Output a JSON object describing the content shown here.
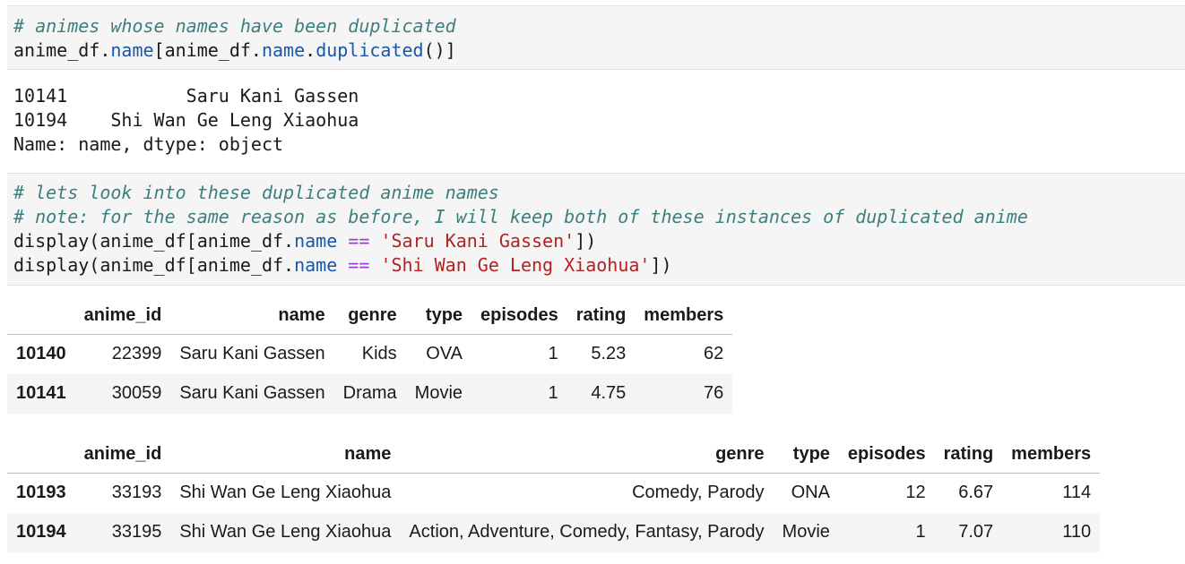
{
  "cell1": {
    "comment": "# animes whose names have been duplicated",
    "code": {
      "obj1": "anime_df.",
      "attr1": "name",
      "bracket1": "[anime_df.",
      "attr2": "name",
      "dot": ".",
      "fn": "duplicated",
      "tail": "()]"
    }
  },
  "output1": {
    "lines": [
      "10141           Saru Kani Gassen",
      "10194    Shi Wan Ge Leng Xiaohua",
      "Name: name, dtype: object"
    ]
  },
  "cell2": {
    "comment1": "# lets look into these duplicated anime names",
    "comment2": "# note: for the same reason as before, I will keep both of these instances of duplicated anime",
    "line3": {
      "pre": "display(anime_df[anime_df.",
      "attr": "name",
      "op": "==",
      "str": "'Saru Kani Gassen'",
      "post": "])"
    },
    "line4": {
      "pre": "display(anime_df[anime_df.",
      "attr": "name",
      "op": "==",
      "str": "'Shi Wan Ge Leng Xiaohua'",
      "post": "])"
    }
  },
  "table1": {
    "columns": [
      "anime_id",
      "name",
      "genre",
      "type",
      "episodes",
      "rating",
      "members"
    ],
    "rows": [
      {
        "index": "10140",
        "anime_id": "22399",
        "name": "Saru Kani Gassen",
        "genre": "Kids",
        "type": "OVA",
        "episodes": "1",
        "rating": "5.23",
        "members": "62"
      },
      {
        "index": "10141",
        "anime_id": "30059",
        "name": "Saru Kani Gassen",
        "genre": "Drama",
        "type": "Movie",
        "episodes": "1",
        "rating": "4.75",
        "members": "76"
      }
    ]
  },
  "table2": {
    "columns": [
      "anime_id",
      "name",
      "genre",
      "type",
      "episodes",
      "rating",
      "members"
    ],
    "rows": [
      {
        "index": "10193",
        "anime_id": "33193",
        "name": "Shi Wan Ge Leng Xiaohua",
        "genre": "Comedy, Parody",
        "type": "ONA",
        "episodes": "12",
        "rating": "6.67",
        "members": "114"
      },
      {
        "index": "10194",
        "anime_id": "33195",
        "name": "Shi Wan Ge Leng Xiaohua",
        "genre": "Action, Adventure, Comedy, Fantasy, Parody",
        "type": "Movie",
        "episodes": "1",
        "rating": "7.07",
        "members": "110"
      }
    ]
  }
}
